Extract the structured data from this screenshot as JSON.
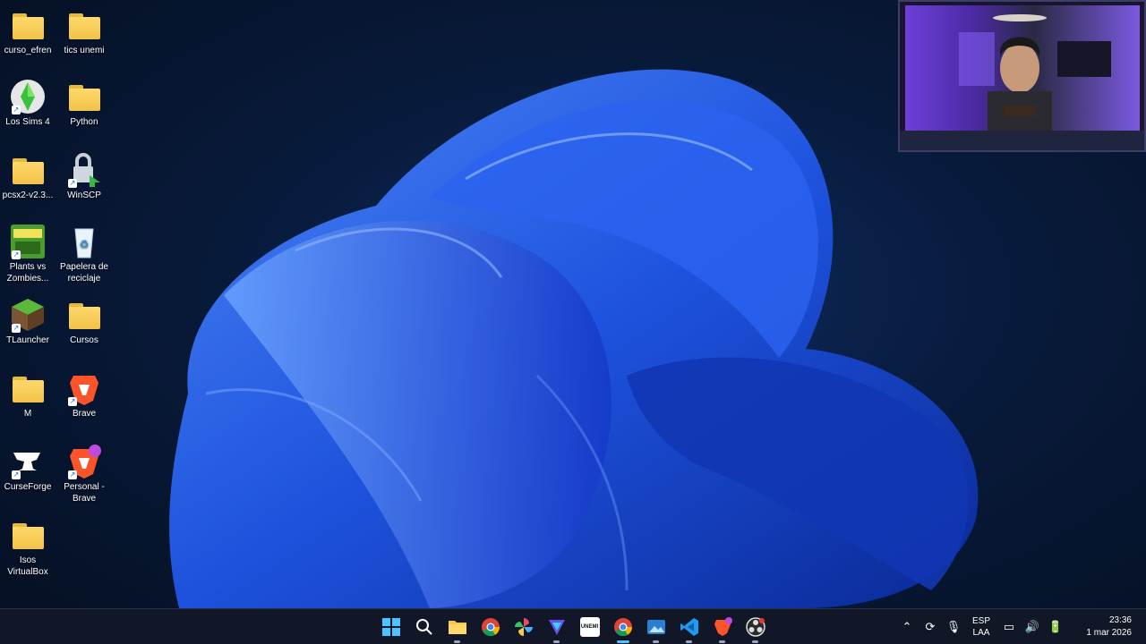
{
  "desktop": {
    "icons": [
      {
        "label": "curso_efren",
        "kind": "folder"
      },
      {
        "label": "tics unemi",
        "kind": "folder"
      },
      {
        "label": "Los Sims 4",
        "kind": "sims-icon"
      },
      {
        "label": "Python",
        "kind": "folder"
      },
      {
        "label": "pcsx2-v2.3...",
        "kind": "folder"
      },
      {
        "label": "WinSCP",
        "kind": "winscp-icon"
      },
      {
        "label": "Plants vs Zombies...",
        "kind": "pvz-icon"
      },
      {
        "label": "Papelera de reciclaje",
        "kind": "recycle-bin-icon"
      },
      {
        "label": "TLauncher",
        "kind": "minecraft-icon"
      },
      {
        "label": "Cursos",
        "kind": "folder"
      },
      {
        "label": "M",
        "kind": "folder"
      },
      {
        "label": "Brave",
        "kind": "brave-icon"
      },
      {
        "label": "CurseForge",
        "kind": "curseforge-icon"
      },
      {
        "label": "Personal - Brave",
        "kind": "brave-icon"
      },
      {
        "label": "Isos VirtualBox",
        "kind": "folder"
      }
    ]
  },
  "taskbar": {
    "apps": [
      {
        "name": "start-button",
        "icon": "windows-icon"
      },
      {
        "name": "search-button",
        "icon": "search-icon"
      },
      {
        "name": "file-explorer",
        "icon": "folder-icon"
      },
      {
        "name": "chrome",
        "icon": "chrome-icon"
      },
      {
        "name": "photos",
        "icon": "pinwheel-icon"
      },
      {
        "name": "app-1",
        "icon": "vpn-icon"
      },
      {
        "name": "unemi",
        "icon": "unemi-icon",
        "text": "UNEMI"
      },
      {
        "name": "chrome-active",
        "icon": "chrome-icon"
      },
      {
        "name": "app-2",
        "icon": "image-icon"
      },
      {
        "name": "vscode",
        "icon": "vscode-icon"
      },
      {
        "name": "brave",
        "icon": "brave-icon"
      },
      {
        "name": "obs",
        "icon": "obs-icon"
      }
    ],
    "tray": {
      "lang_top": "ESP",
      "lang_bottom": "LAA",
      "time": "23:36",
      "date": "1 mar 2026"
    }
  },
  "colors": {
    "accent": "#4cc2ff",
    "wallpaper_blue": "#1f55e6",
    "folder": "#f5c84c"
  }
}
